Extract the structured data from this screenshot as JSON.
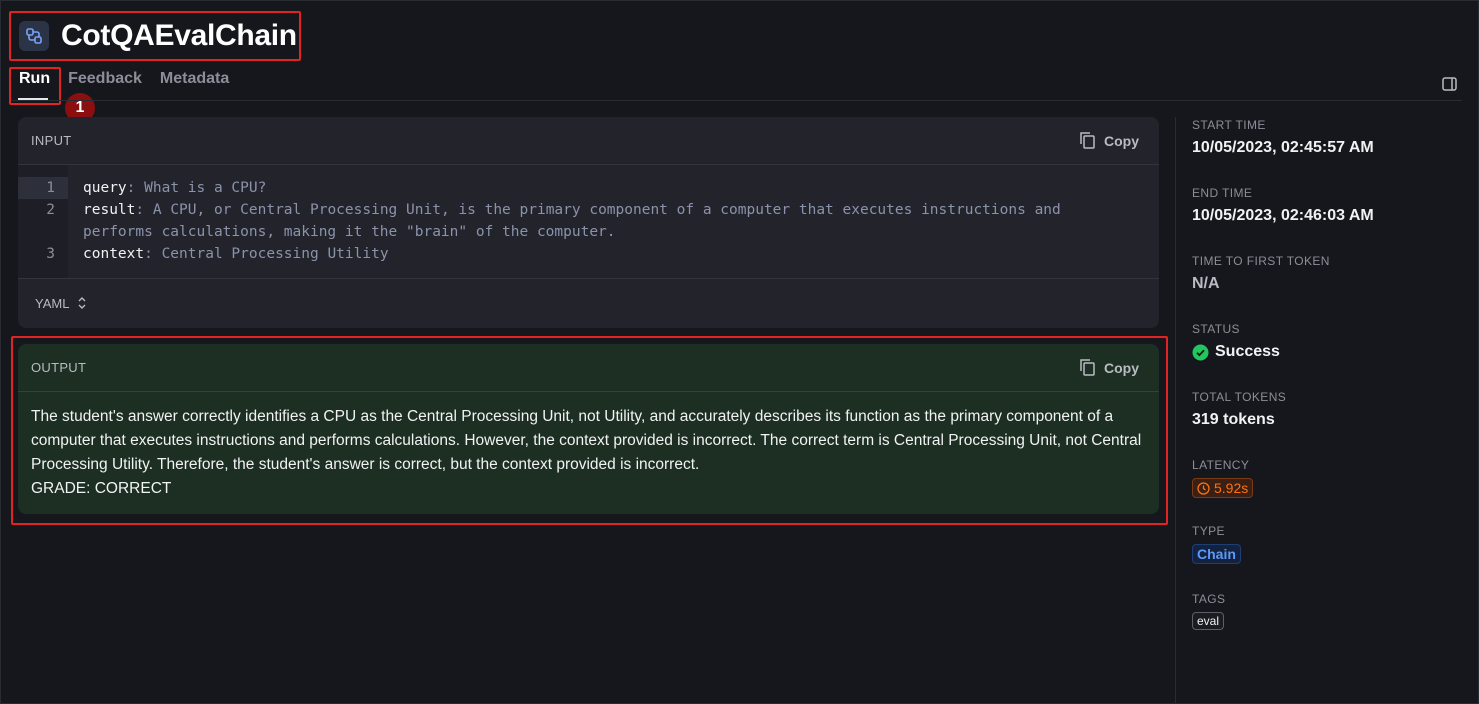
{
  "header": {
    "title": "CotQAEvalChain",
    "icon": "chain-icon"
  },
  "tabs": [
    {
      "label": "Run",
      "active": true
    },
    {
      "label": "Feedback",
      "active": false
    },
    {
      "label": "Metadata",
      "active": false
    }
  ],
  "annotation_marker": "1",
  "input": {
    "label": "INPUT",
    "copy_label": "Copy",
    "format_label": "YAML",
    "lines": [
      {
        "num": "1",
        "key": "query",
        "value": "What is a CPU?"
      },
      {
        "num": "2",
        "key": "result",
        "value": "A CPU, or Central Processing Unit, is the primary component of a computer that executes instructions and performs calculations, making it the \"brain\" of the computer."
      },
      {
        "num": "3",
        "key": "context",
        "value": "Central Processing Utility"
      }
    ]
  },
  "output": {
    "label": "OUTPUT",
    "copy_label": "Copy",
    "text": "The student's answer correctly identifies a CPU as the Central Processing Unit, not Utility, and accurately describes its function as the primary component of a computer that executes instructions and performs calculations. However, the context provided is incorrect. The correct term is Central Processing Unit, not Central Processing Utility. Therefore, the student's answer is correct, but the context provided is incorrect.",
    "grade": "GRADE: CORRECT"
  },
  "sidebar": {
    "start_time": {
      "label": "START TIME",
      "value": "10/05/2023, 02:45:57 AM"
    },
    "end_time": {
      "label": "END TIME",
      "value": "10/05/2023, 02:46:03 AM"
    },
    "ttft": {
      "label": "TIME TO FIRST TOKEN",
      "value": "N/A"
    },
    "status": {
      "label": "STATUS",
      "value": "Success",
      "color": "#22c55e"
    },
    "total_tokens": {
      "label": "TOTAL TOKENS",
      "value": "319 tokens"
    },
    "latency": {
      "label": "LATENCY",
      "value": "5.92s",
      "color": "#f97316"
    },
    "type": {
      "label": "TYPE",
      "value": "Chain",
      "color": "#5b9af8"
    },
    "tags": {
      "label": "TAGS",
      "items": [
        "eval"
      ]
    }
  }
}
